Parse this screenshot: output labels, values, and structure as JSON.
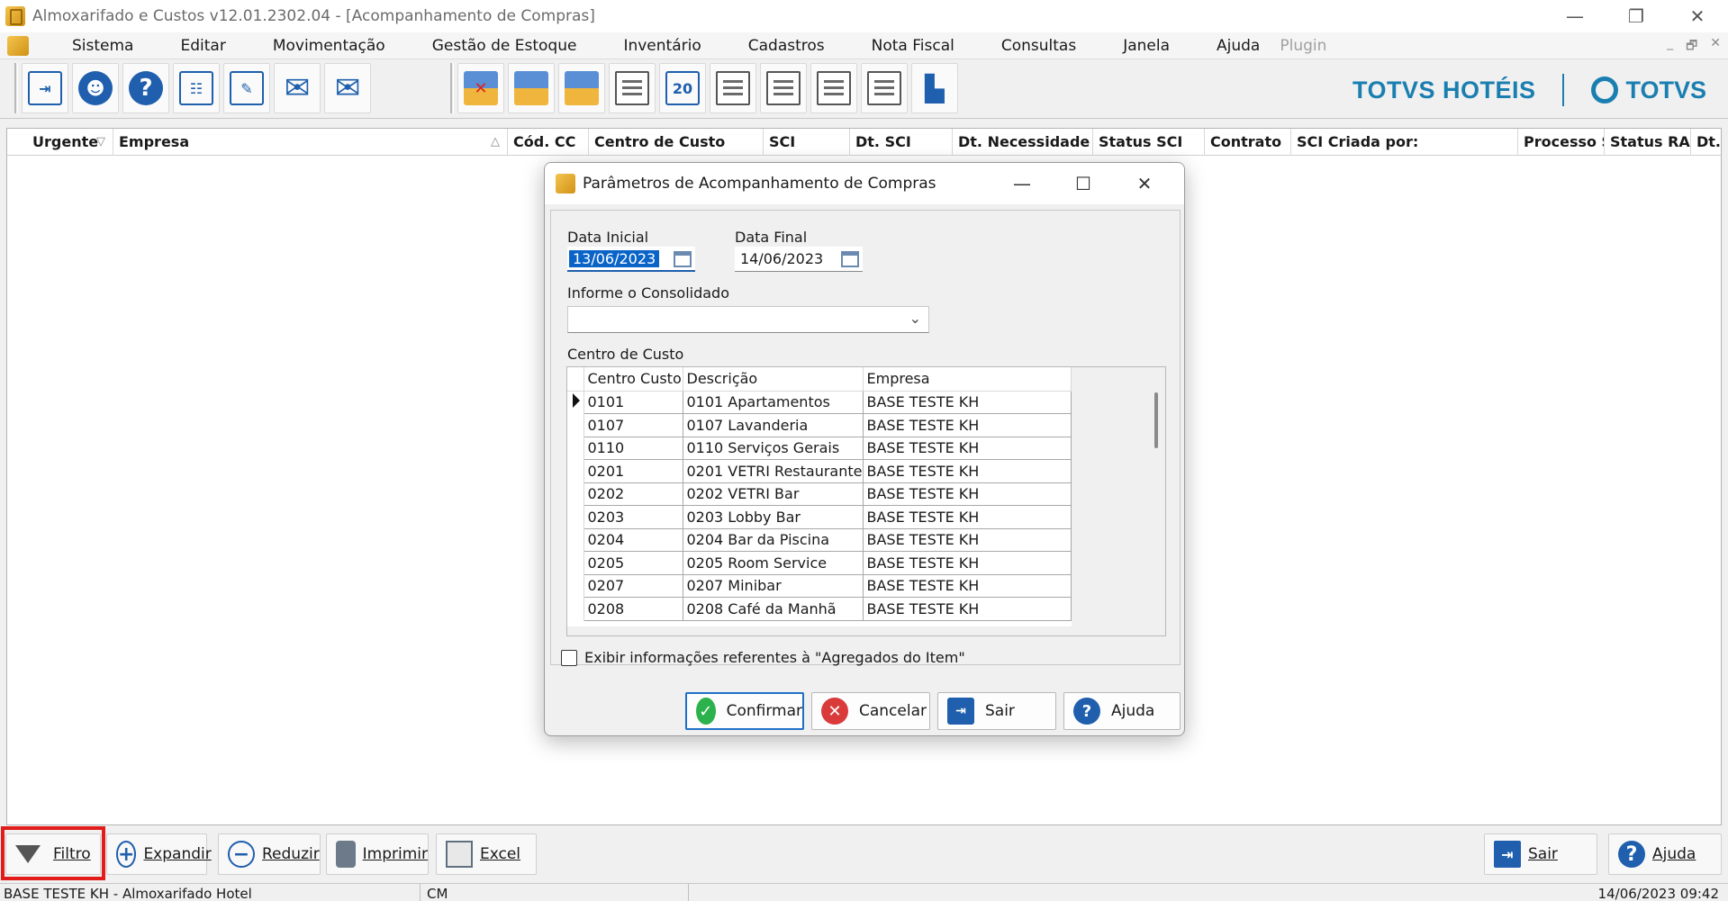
{
  "window": {
    "title": "Almoxarifado e Custos v12.01.2302.04 - [Acompanhamento de Compras]",
    "controls": [
      "—",
      "❐",
      "✕"
    ]
  },
  "menu": {
    "items": [
      "Sistema",
      "Editar",
      "Movimentação",
      "Gestão de Estoque",
      "Inventário",
      "Cadastros",
      "Nota Fiscal",
      "Consultas",
      "Janela",
      "Ajuda"
    ],
    "plugin": "Plugin",
    "mdi_controls": [
      "_",
      "🗗",
      "✕"
    ]
  },
  "toolbar": {
    "icons": [
      "exit-icon",
      "user-key-icon",
      "help-icon",
      "org-chart-icon",
      "edit-sheet-icon",
      "mail-icon",
      "mail-send-icon",
      "truck-cancel-icon",
      "truck-box-icon",
      "computer-box-icon",
      "clipboard-icon",
      "calendar-20-icon",
      "clipboard-lock-icon",
      "report-icon",
      "screen-report-icon",
      "users-report-icon",
      "factory-icon"
    ]
  },
  "brand": {
    "left": "TOTVS HOTÉIS",
    "right": "TOTVS"
  },
  "grid": {
    "columns": [
      "Urgente",
      "Empresa",
      "Cód. CC",
      "Centro de Custo",
      "SCI",
      "Dt. SCI",
      "Dt. Necessidade",
      "Status SCI",
      "Contrato",
      "SCI Criada por:",
      "Processo S",
      "Status RAI",
      "Dt."
    ],
    "urgente_sort": "▽",
    "empresa_sort": "△"
  },
  "dialog": {
    "title": "Parâmetros de Acompanhamento de Compras",
    "data_inicial_label": "Data Inicial",
    "data_inicial": "13/06/2023",
    "data_final_label": "Data Final",
    "data_final": "14/06/2023",
    "consolidado_label": "Informe o Consolidado",
    "consolidado_value": "",
    "centro_label": "Centro de Custo",
    "cc_columns": [
      "Centro Custo",
      "Descrição",
      "Empresa"
    ],
    "cc_rows": [
      [
        "0101",
        "0101 Apartamentos",
        "BASE TESTE KH"
      ],
      [
        "0107",
        "0107 Lavanderia",
        "BASE TESTE KH"
      ],
      [
        "0110",
        "0110 Serviços Gerais",
        "BASE TESTE KH"
      ],
      [
        "0201",
        "0201 VETRI Restaurante",
        "BASE TESTE KH"
      ],
      [
        "0202",
        "0202 VETRI Bar",
        "BASE TESTE KH"
      ],
      [
        "0203",
        "0203 Lobby Bar",
        "BASE TESTE KH"
      ],
      [
        "0204",
        "0204 Bar da Piscina",
        "BASE TESTE KH"
      ],
      [
        "0205",
        "0205 Room Service",
        "BASE TESTE KH"
      ],
      [
        "0207",
        "0207 Minibar",
        "BASE TESTE KH"
      ],
      [
        "0208",
        "0208 Café da Manhã",
        "BASE TESTE KH"
      ]
    ],
    "checkbox_label": "Exibir informações referentes à \"Agregados do Item\"",
    "buttons": {
      "confirmar": "Confirmar",
      "cancelar": "Cancelar",
      "sair": "Sair",
      "ajuda": "Ajuda"
    }
  },
  "bottombar": {
    "filtro": "Filtro",
    "expandir": "Expandir",
    "reduzir": "Reduzir",
    "imprimir": "Imprimir",
    "excel": "Excel",
    "sair": "Sair",
    "ajuda": "Ajuda"
  },
  "status": {
    "company": "BASE TESTE KH - Almoxarifado Hotel",
    "mode": "CM",
    "datetime": "14/06/2023 09:42"
  },
  "colors": {
    "accent": "#1f5fad",
    "brand": "#1a7fb0",
    "highlight": "#e21b1b"
  }
}
